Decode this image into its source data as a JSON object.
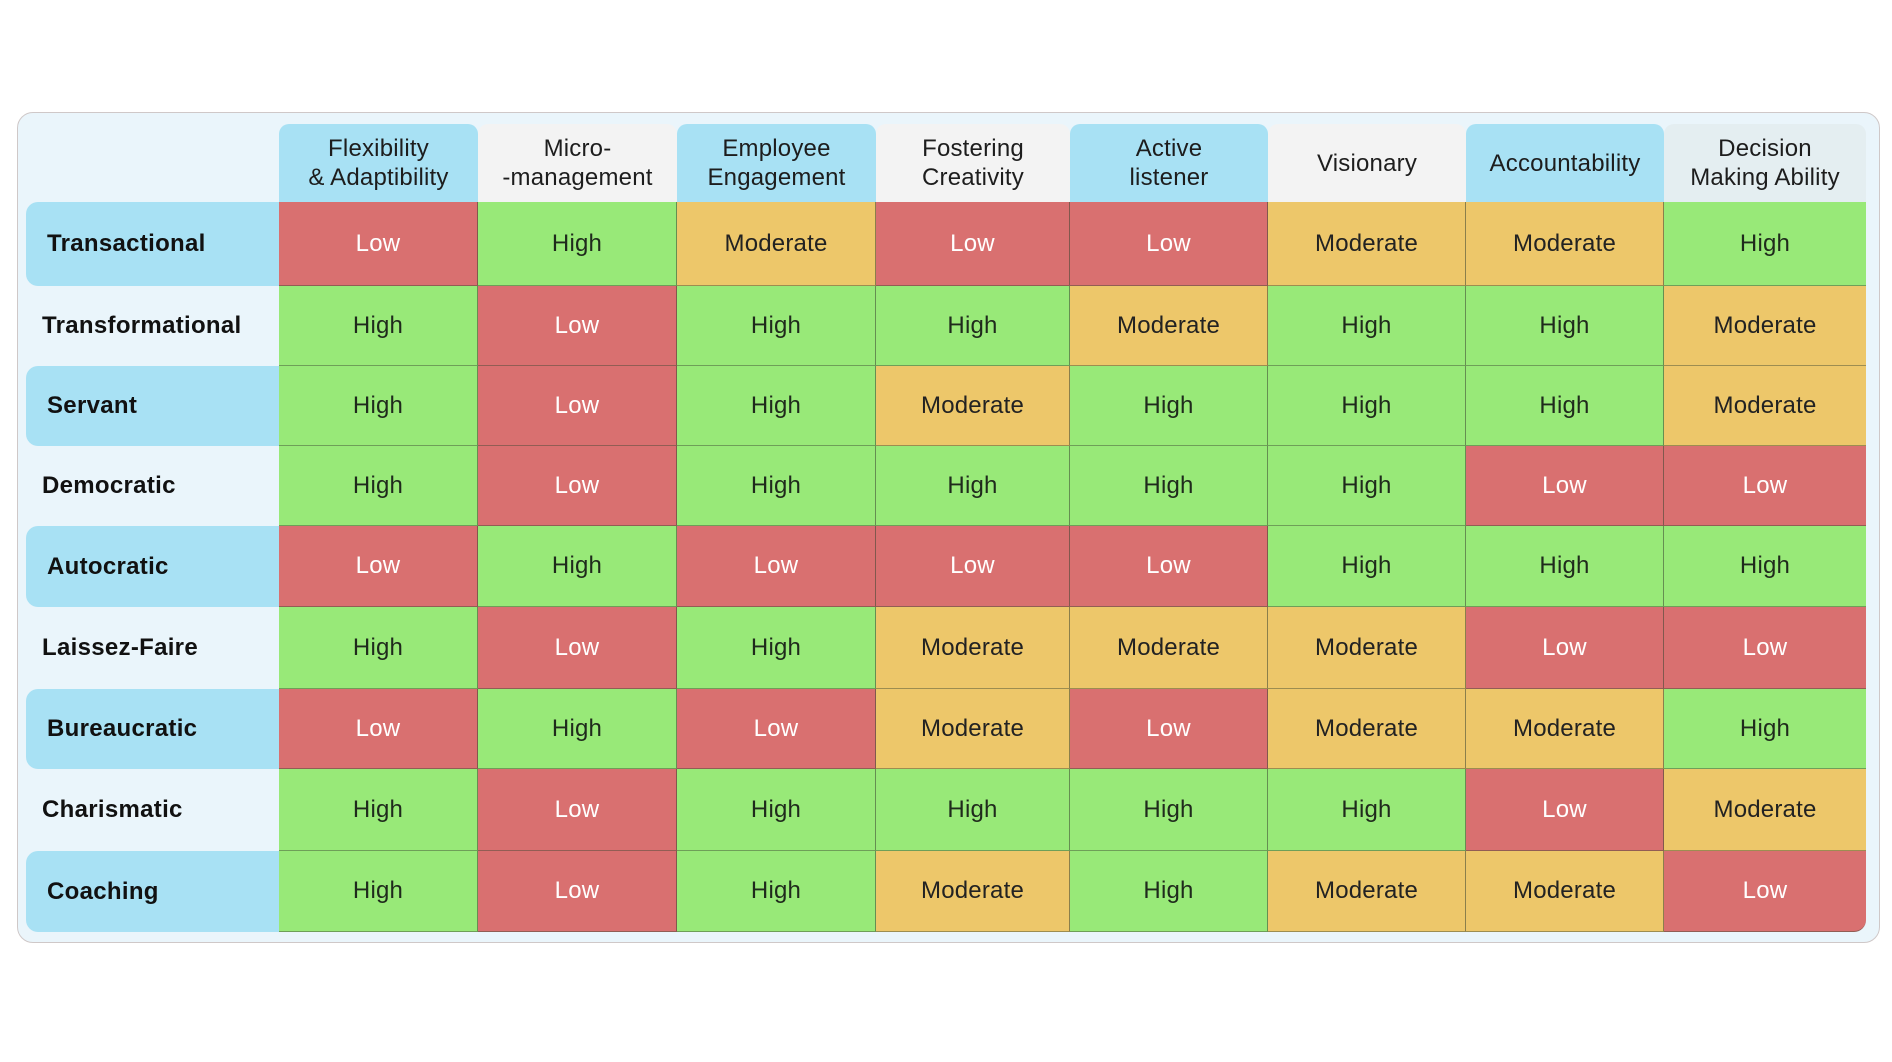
{
  "colors": {
    "High": "#98e978",
    "Low": "#d97070",
    "Moderate": "#edc76a",
    "header_blue": "#a8e1f4",
    "header_gray": "#f3f3f3",
    "card_bg": "#eaf5fb"
  },
  "table": {
    "columns": [
      {
        "label": "Flexibility\n& Adaptibility",
        "style": "blue"
      },
      {
        "label": "Micro-\n-management",
        "style": "gray"
      },
      {
        "label": "Employee\nEngagement",
        "style": "blue"
      },
      {
        "label": "Fostering\nCreativity",
        "style": "gray"
      },
      {
        "label": "Active\nlistener",
        "style": "blue"
      },
      {
        "label": "Visionary",
        "style": "gray"
      },
      {
        "label": "Accountability",
        "style": "blue"
      },
      {
        "label": "Decision\nMaking Ability",
        "style": "gray2"
      }
    ],
    "rows": [
      {
        "label": "Transactional",
        "style": "blue",
        "values": [
          "Low",
          "High",
          "Moderate",
          "Low",
          "Low",
          "Moderate",
          "Moderate",
          "High"
        ]
      },
      {
        "label": "Transformational",
        "style": "plain",
        "values": [
          "High",
          "Low",
          "High",
          "High",
          "Moderate",
          "High",
          "High",
          "Moderate"
        ]
      },
      {
        "label": "Servant",
        "style": "blue",
        "values": [
          "High",
          "Low",
          "High",
          "Moderate",
          "High",
          "High",
          "High",
          "Moderate"
        ]
      },
      {
        "label": "Democratic",
        "style": "plain",
        "values": [
          "High",
          "Low",
          "High",
          "High",
          "High",
          "High",
          "Low",
          "Low"
        ]
      },
      {
        "label": "Autocratic",
        "style": "blue",
        "values": [
          "Low",
          "High",
          "Low",
          "Low",
          "Low",
          "High",
          "High",
          "High"
        ]
      },
      {
        "label": "Laissez-Faire",
        "style": "plain",
        "values": [
          "High",
          "Low",
          "High",
          "Moderate",
          "Moderate",
          "Moderate",
          "Low",
          "Low"
        ]
      },
      {
        "label": "Bureaucratic",
        "style": "blue",
        "values": [
          "Low",
          "High",
          "Low",
          "Moderate",
          "Low",
          "Moderate",
          "Moderate",
          "High"
        ]
      },
      {
        "label": "Charismatic",
        "style": "plain",
        "values": [
          "High",
          "Low",
          "High",
          "High",
          "High",
          "High",
          "Low",
          "Moderate"
        ]
      },
      {
        "label": "Coaching",
        "style": "blue",
        "values": [
          "High",
          "Low",
          "High",
          "Moderate",
          "High",
          "Moderate",
          "Moderate",
          "Low"
        ]
      }
    ]
  }
}
